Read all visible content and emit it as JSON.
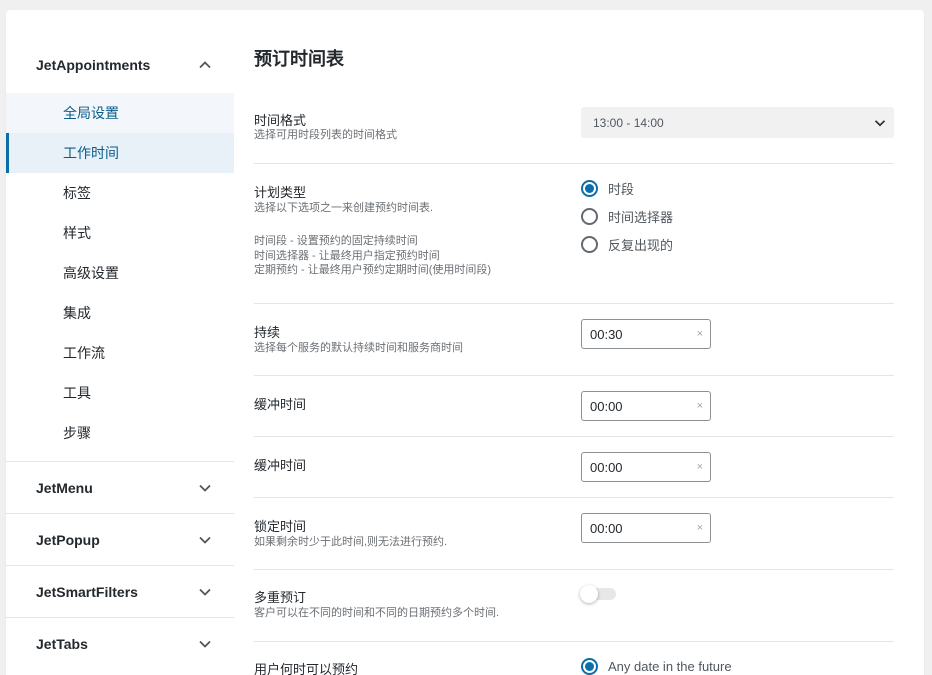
{
  "sidebar": {
    "plugins": [
      {
        "name": "JetAppointments",
        "expanded": true,
        "icon": "chevron-up-icon"
      },
      {
        "name": "JetMenu",
        "expanded": false,
        "icon": "chevron-down-icon"
      },
      {
        "name": "JetPopup",
        "expanded": false,
        "icon": "chevron-down-icon"
      },
      {
        "name": "JetSmartFilters",
        "expanded": false,
        "icon": "chevron-down-icon"
      },
      {
        "name": "JetTabs",
        "expanded": false,
        "icon": "chevron-down-icon"
      }
    ],
    "sub_items": [
      "全局设置",
      "工作时间",
      "标签",
      "样式",
      "高级设置",
      "集成",
      "工作流",
      "工具",
      "步骤"
    ],
    "active_item": "工作时间"
  },
  "main": {
    "title": "预订时间表",
    "time_format": {
      "label": "时间格式",
      "desc": "选择可用时段列表的时间格式",
      "value": "13:00 - 14:00"
    },
    "schedule_type": {
      "label": "计划类型",
      "desc": "选择以下选项之一来创建预约时间表.",
      "notes": [
        "时间段 - 设置预约的固定持续时间",
        "时间选择器 - 让最终用户指定预约时间",
        "定期预约 - 让最终用户预约定期时间(使用时间段)"
      ],
      "options": [
        "时段",
        "时间选择器",
        "反复出现的"
      ],
      "selected": "时段"
    },
    "duration": {
      "label": "持续",
      "desc": "选择每个服务的默认持续时间和服务商时间",
      "value": "00:30"
    },
    "buffer_before": {
      "label": "缓冲时间",
      "value": "00:00"
    },
    "buffer_after": {
      "label": "缓冲时间",
      "value": "00:00"
    },
    "lock_time": {
      "label": "锁定时间",
      "desc": "如果剩余时少于此时间,则无法进行预约.",
      "value": "00:00"
    },
    "multi_booking": {
      "label": "多重预订",
      "desc": "客户可以在不同的时间和不同的日期预约多个时间.",
      "enabled": false
    },
    "booking_window": {
      "label": "用户何时可以预约",
      "option": "Any date in the future",
      "selected": true
    }
  },
  "colors": {
    "accent": "#0b6ea8",
    "active_bg": "#e8f0f8",
    "page_bg": "#f0f0f1"
  },
  "clear_glyph": "×"
}
